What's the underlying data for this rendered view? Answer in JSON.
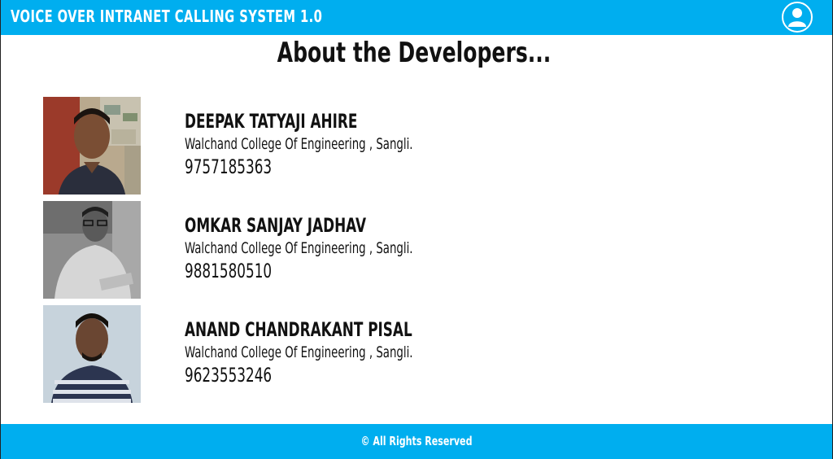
{
  "header": {
    "title": "VOICE OVER INTRANET CALLING SYSTEM 1.0",
    "profile_icon": "user-avatar-icon"
  },
  "page": {
    "heading": "About the Developers..."
  },
  "developers": [
    {
      "name": "DEEPAK TATYAJI AHIRE",
      "college": "Walchand College Of  Engineering , Sangli.",
      "phone": "9757185363"
    },
    {
      "name": "OMKAR SANJAY JADHAV",
      "college": " Walchand College Of  Engineering , Sangli.",
      "phone": "9881580510"
    },
    {
      "name": "ANAND CHANDRAKANT PISAL",
      "college": "Walchand College Of  Engineering , Sangli.",
      "phone": "9623553246"
    }
  ],
  "footer": {
    "text": "© All Rights Reserved"
  },
  "colors": {
    "accent": "#00aeef",
    "text": "#111111",
    "background": "#ffffff"
  }
}
